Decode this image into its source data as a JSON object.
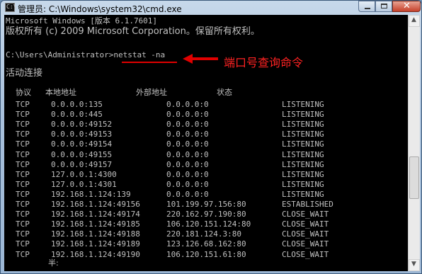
{
  "window": {
    "title": "管理员: C:\\Windows\\system32\\cmd.exe",
    "icon": "cmd-icon"
  },
  "console": {
    "header_line1": "Microsoft Windows [版本 6.1.7601]",
    "header_line2": "版权所有 (c) 2009 Microsoft Corporation。保留所有权利。",
    "prompt": "C:\\Users\\Administrator>",
    "command": "netstat -na",
    "annotation": "端口号查询命令",
    "section_title": "活动连接",
    "headers": {
      "proto": "协议",
      "local": "本地地址",
      "foreign": "外部地址",
      "state": "状态"
    },
    "rows": [
      {
        "proto": "TCP",
        "local": "0.0.0.0:135",
        "foreign": "0.0.0.0:0",
        "state": "LISTENING"
      },
      {
        "proto": "TCP",
        "local": "0.0.0.0:445",
        "foreign": "0.0.0.0:0",
        "state": "LISTENING"
      },
      {
        "proto": "TCP",
        "local": "0.0.0.0:49152",
        "foreign": "0.0.0.0:0",
        "state": "LISTENING"
      },
      {
        "proto": "TCP",
        "local": "0.0.0.0:49153",
        "foreign": "0.0.0.0:0",
        "state": "LISTENING"
      },
      {
        "proto": "TCP",
        "local": "0.0.0.0:49154",
        "foreign": "0.0.0.0:0",
        "state": "LISTENING"
      },
      {
        "proto": "TCP",
        "local": "0.0.0.0:49155",
        "foreign": "0.0.0.0:0",
        "state": "LISTENING"
      },
      {
        "proto": "TCP",
        "local": "0.0.0.0:49157",
        "foreign": "0.0.0.0:0",
        "state": "LISTENING"
      },
      {
        "proto": "TCP",
        "local": "127.0.0.1:4300",
        "foreign": "0.0.0.0:0",
        "state": "LISTENING"
      },
      {
        "proto": "TCP",
        "local": "127.0.0.1:4301",
        "foreign": "0.0.0.0:0",
        "state": "LISTENING"
      },
      {
        "proto": "TCP",
        "local": "192.168.1.124:139",
        "foreign": "0.0.0.0:0",
        "state": "LISTENING"
      },
      {
        "proto": "TCP",
        "local": "192.168.1.124:49156",
        "foreign": "101.199.97.156:80",
        "state": "ESTABLISHED"
      },
      {
        "proto": "TCP",
        "local": "192.168.1.124:49174",
        "foreign": "220.162.97.190:80",
        "state": "CLOSE_WAIT"
      },
      {
        "proto": "TCP",
        "local": "192.168.1.124:49185",
        "foreign": "106.120.151.124:80",
        "state": "CLOSE_WAIT"
      },
      {
        "proto": "TCP",
        "local": "192.168.1.124:49188",
        "foreign": "220.181.124.3:80",
        "state": "CLOSE_WAIT"
      },
      {
        "proto": "TCP",
        "local": "192.168.1.124:49189",
        "foreign": "123.126.68.162:80",
        "state": "CLOSE_WAIT"
      },
      {
        "proto": "TCP",
        "local": "192.168.1.124:49190",
        "foreign": "106.120.151.61:80",
        "state": "CLOSE_WAIT"
      }
    ],
    "trailing": "半:"
  },
  "colors": {
    "console_bg": "#000000",
    "console_text": "#c0c0c0",
    "annotation": "#ff2222"
  }
}
